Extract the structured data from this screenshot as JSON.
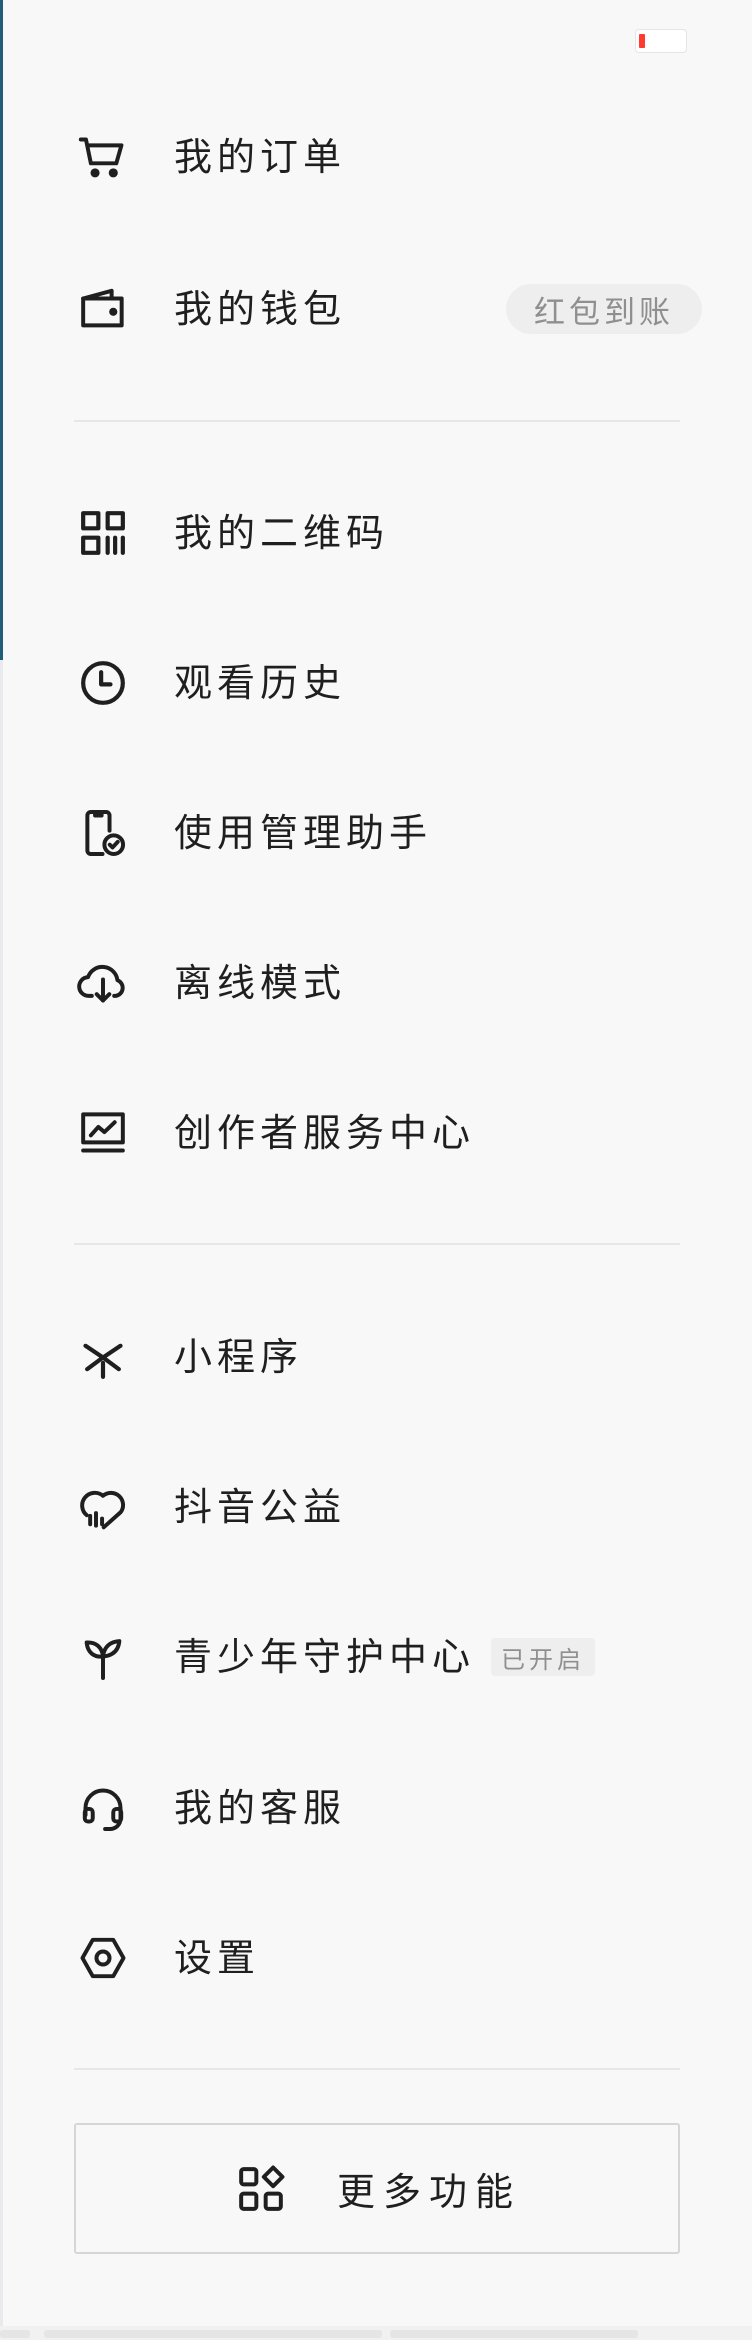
{
  "menu": {
    "items": [
      {
        "icon": "shopping-cart-icon",
        "label": "我的订单"
      },
      {
        "icon": "wallet-icon",
        "label": "我的钱包",
        "badge": "红包到账"
      },
      {
        "icon": "qr-code-icon",
        "label": "我的二维码"
      },
      {
        "icon": "clock-icon",
        "label": "观看历史"
      },
      {
        "icon": "phone-check-icon",
        "label": "使用管理助手"
      },
      {
        "icon": "cloud-download-icon",
        "label": "离线模式"
      },
      {
        "icon": "monitor-chart-icon",
        "label": "创作者服务中心"
      },
      {
        "icon": "mini-program-icon",
        "label": "小程序"
      },
      {
        "icon": "heart-charity-icon",
        "label": "抖音公益"
      },
      {
        "icon": "sprout-icon",
        "label": "青少年守护中心",
        "tag": "已开启"
      },
      {
        "icon": "headset-icon",
        "label": "我的客服"
      },
      {
        "icon": "settings-hex-icon",
        "label": "设置"
      }
    ]
  },
  "more_button": {
    "icon": "apps-grid-icon",
    "label": "更多功能"
  },
  "colors": {
    "background": "#f8f8f8",
    "text": "#1f1f1f",
    "badge_bg": "#eeeeee",
    "badge_text": "#8f8f8f",
    "indicator_red": "#ff3b30"
  }
}
